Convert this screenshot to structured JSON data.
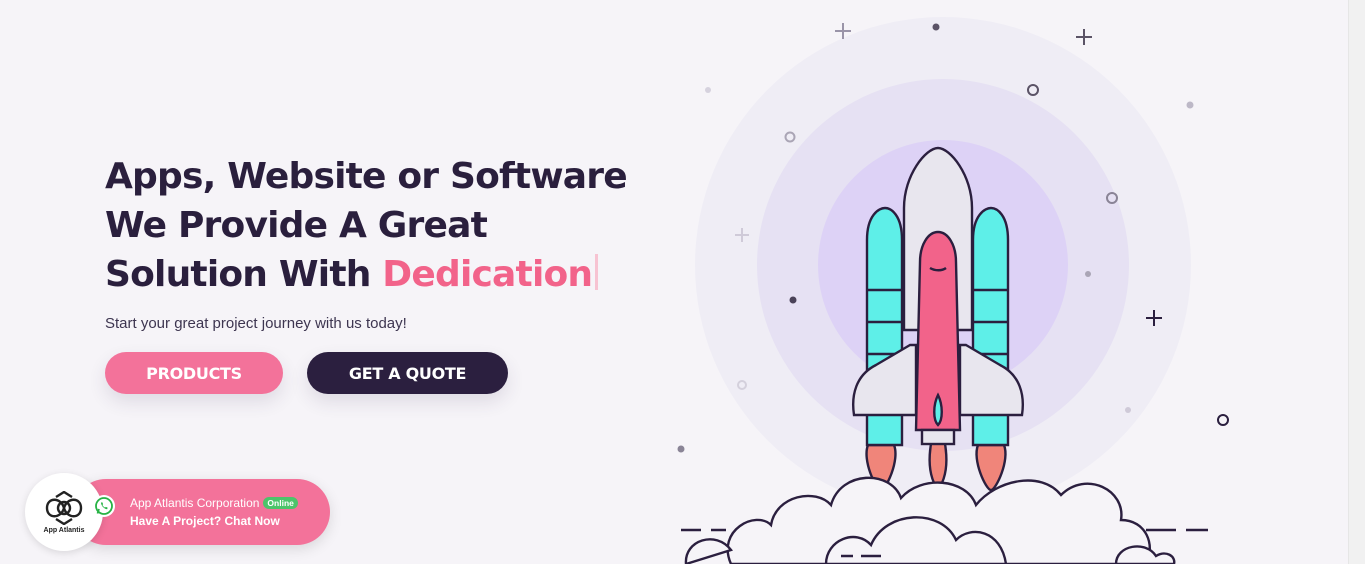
{
  "hero": {
    "headline_line1": "Apps, Website or Software",
    "headline_line2": "We Provide A Great",
    "headline_line3_prefix": "Solution With ",
    "headline_accent": "Dedication",
    "subtitle": "Start your great project journey with us today!"
  },
  "buttons": {
    "products_label": "PRODUCTS",
    "quote_label": "GET A QUOTE"
  },
  "chat": {
    "logo_text": "App Atlantis",
    "company": "App Atlantis Corporation",
    "status": "Online",
    "cta": "Have A Project? Chat Now",
    "icon": "whatsapp-icon"
  },
  "illustration": {
    "subject": "rocket-launch-illustration"
  },
  "colors": {
    "accent_pink": "#f2638a",
    "button_pink": "#f3729a",
    "dark_navy": "#2b1f3f",
    "rocket_teal": "#5eefe8",
    "online_green": "#4cc46a"
  }
}
